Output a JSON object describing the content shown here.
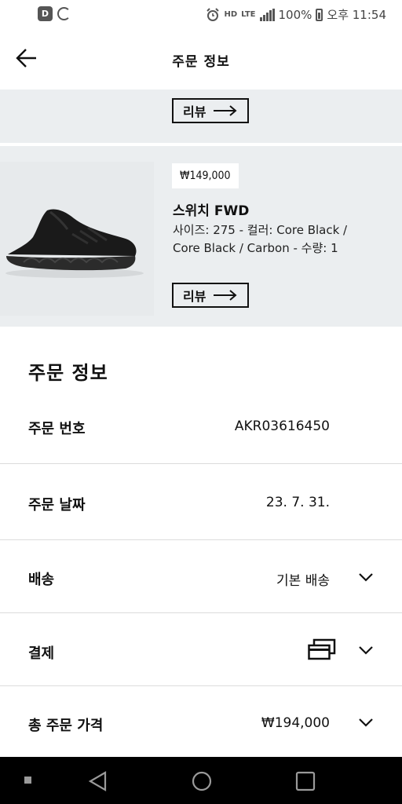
{
  "status_bar": {
    "left_icons": [
      "d-icon",
      "sync-icon"
    ],
    "battery": "100%",
    "time": "오후 11:54",
    "hd_label": "HD",
    "lte_label": "LTE"
  },
  "header": {
    "title": "주문 정보"
  },
  "products": [
    {
      "review_label": "리뷰"
    },
    {
      "price": "₩149,000",
      "name": "스위치 FWD",
      "options": "사이즈: 275 - 컬러: Core Black / Core Black / Carbon - 수량: 1",
      "review_label": "리뷰"
    }
  ],
  "order_info": {
    "title": "주문 정보",
    "rows": [
      {
        "label": "주문 번호",
        "value": "AKR03616450"
      },
      {
        "label": "주문 날짜",
        "value": "23. 7. 31."
      },
      {
        "label": "배송",
        "value": "기본 배송"
      },
      {
        "label": "결제",
        "value": ""
      },
      {
        "label": "총 주문 가격",
        "value": "₩194,000"
      }
    ]
  },
  "colors": {
    "card_bg": "#ebeef0",
    "text": "#111111",
    "nav_bg": "#000000"
  }
}
